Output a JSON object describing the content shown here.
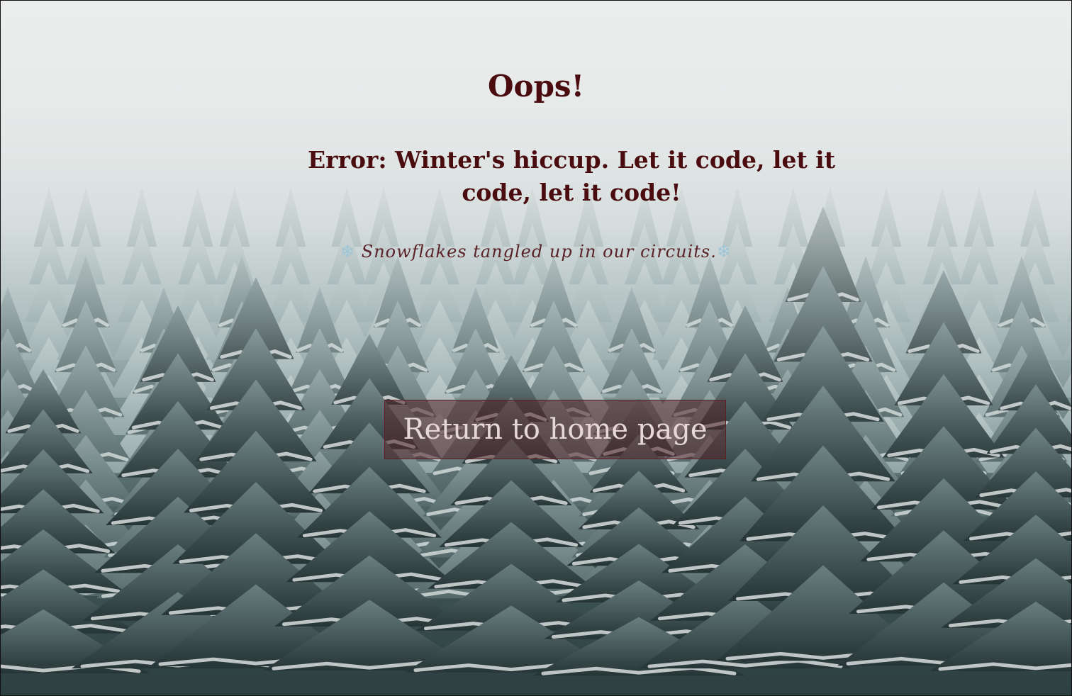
{
  "page": {
    "title": "Oops!",
    "error_message": "Error: Winter's hiccup. Let it code, let it code, let it code!",
    "tagline_prefix_icon": "❄",
    "tagline": "Snowflakes tangled up in our circuits.",
    "tagline_suffix_icon": "❄",
    "home_button_label": "Return to home page"
  },
  "colors": {
    "heading": "#4a0c0f",
    "button_bg": "#50222899",
    "button_text": "#e6d8da",
    "snowflake": "#9ec5d8"
  },
  "icons": {
    "tagline_icons": "snowflake-icon"
  }
}
